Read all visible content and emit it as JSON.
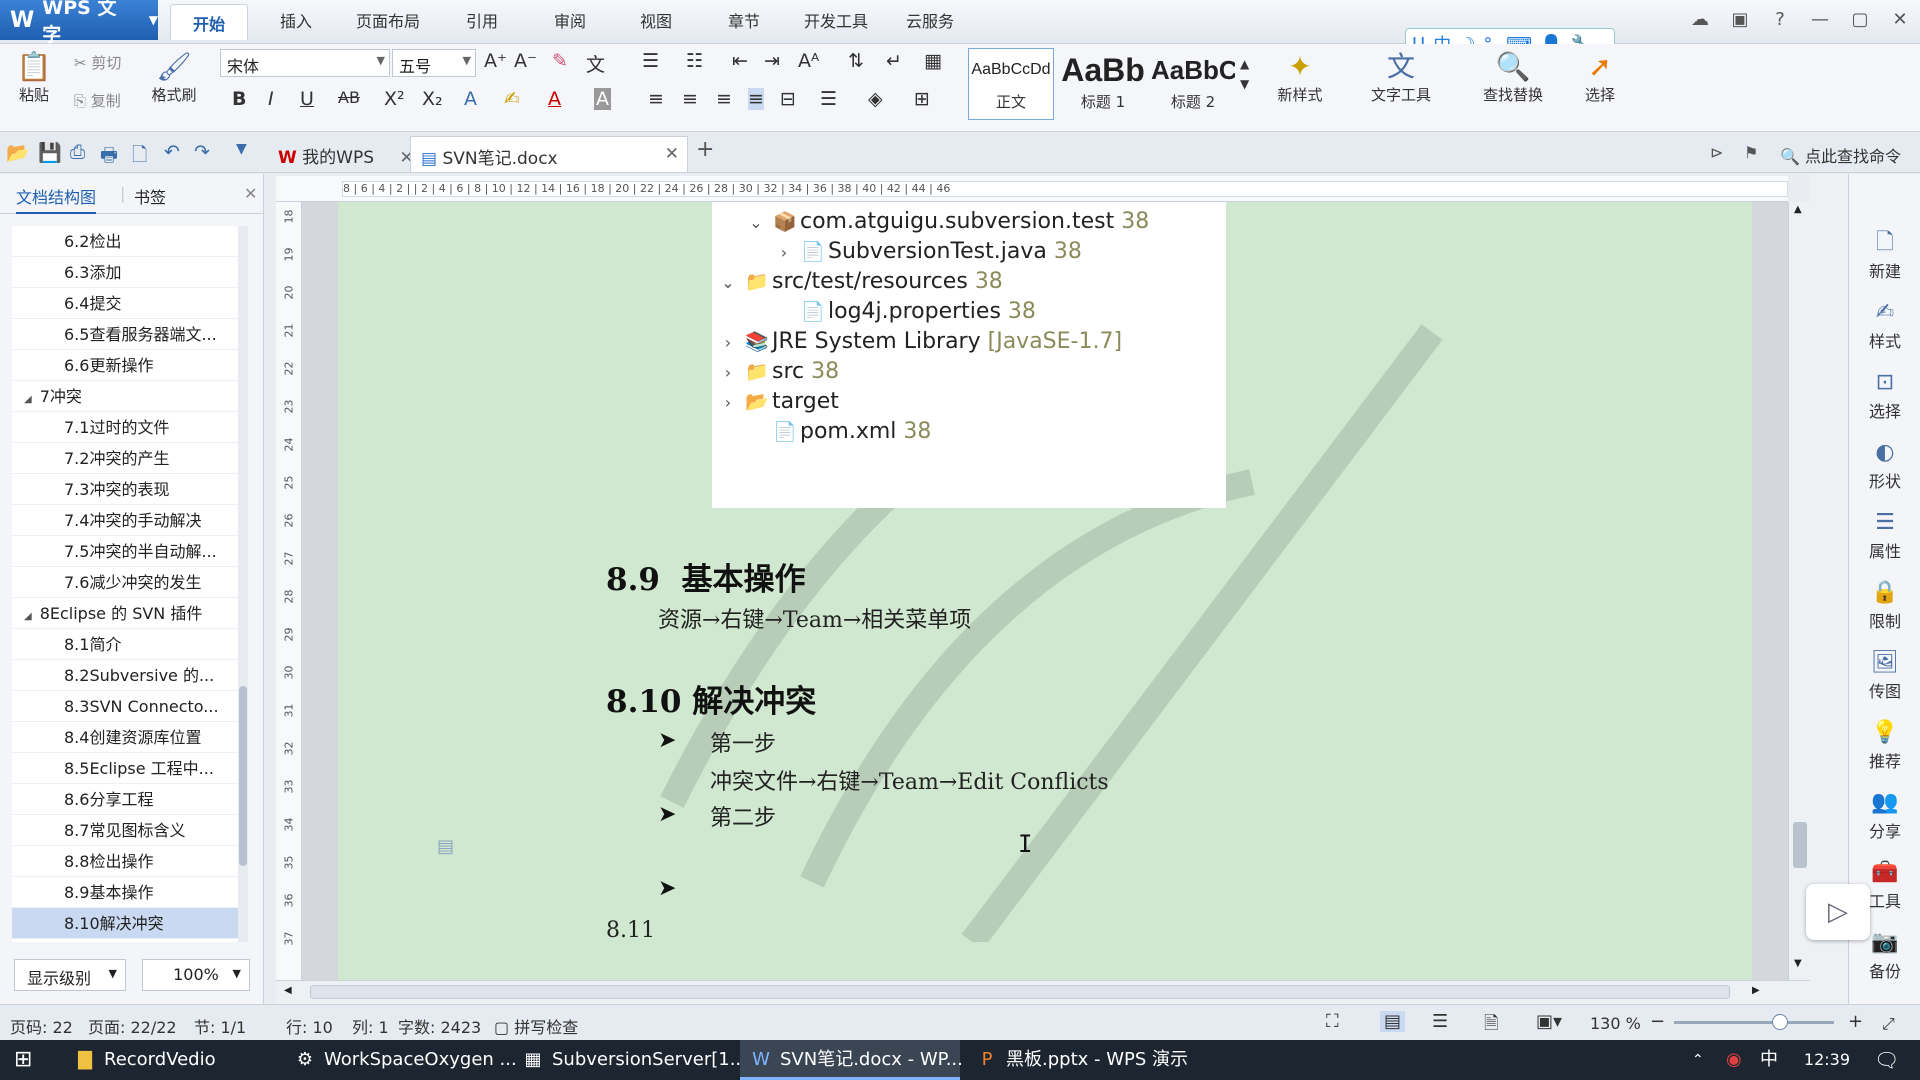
{
  "app": {
    "name": "WPS 文字",
    "logo": "W"
  },
  "menu": [
    "开始",
    "插入",
    "页面布局",
    "引用",
    "审阅",
    "视图",
    "章节",
    "开发工具",
    "云服务"
  ],
  "window_controls": [
    "☁",
    "▣",
    "?",
    "—",
    "▢",
    "✕"
  ],
  "ime": [
    "U",
    "中",
    "☽",
    "°,",
    "⌨",
    "👤",
    "🔧"
  ],
  "ribbon": {
    "paste": "粘贴",
    "cut": "剪切",
    "copy": "复制",
    "format_painter": "格式刷",
    "font_name": "宋体",
    "font_size": "五号",
    "styles": [
      {
        "sample": "AaBbCcDd",
        "label": "正文"
      },
      {
        "sample": "AaBb",
        "label": "标题 1"
      },
      {
        "sample": "AaBbC",
        "label": "标题 2"
      }
    ],
    "new_style": "新样式",
    "text_tools": "文字工具",
    "find_replace": "查找替换",
    "select": "选择"
  },
  "tabs": [
    {
      "label": "我的WPS"
    },
    {
      "label": "SVN笔记.docx"
    }
  ],
  "find_command": "点此查找命令",
  "left_panel": {
    "tab_outline": "文档结构图",
    "tab_bookmark": "书签",
    "items": [
      {
        "label": "6.2检出",
        "level": 2
      },
      {
        "label": "6.3添加",
        "level": 2
      },
      {
        "label": "6.4提交",
        "level": 2
      },
      {
        "label": "6.5查看服务器端文...",
        "level": 2
      },
      {
        "label": "6.6更新操作",
        "level": 2
      },
      {
        "label": "7冲突",
        "level": 1
      },
      {
        "label": "7.1过时的文件",
        "level": 2
      },
      {
        "label": "7.2冲突的产生",
        "level": 2
      },
      {
        "label": "7.3冲突的表现",
        "level": 2
      },
      {
        "label": "7.4冲突的手动解决",
        "level": 2
      },
      {
        "label": "7.5冲突的半自动解...",
        "level": 2
      },
      {
        "label": "7.6减少冲突的发生",
        "level": 2
      },
      {
        "label": "8Eclipse 的 SVN 插件",
        "level": 1
      },
      {
        "label": "8.1简介",
        "level": 2
      },
      {
        "label": "8.2Subversive 的...",
        "level": 2
      },
      {
        "label": "8.3SVN Connecto...",
        "level": 2
      },
      {
        "label": "8.4创建资源库位置",
        "level": 2
      },
      {
        "label": "8.5Eclipse 工程中...",
        "level": 2
      },
      {
        "label": "8.6分享工程",
        "level": 2
      },
      {
        "label": "8.7常见图标含义",
        "level": 2
      },
      {
        "label": "8.8检出操作",
        "level": 2
      },
      {
        "label": "8.9基本操作",
        "level": 2
      },
      {
        "label": "8.10解决冲突",
        "level": 2
      }
    ],
    "show_level": "显示级别",
    "zoom": "100%"
  },
  "hruler_text": "8 | 6 | 4 | 2 |   | 2 | 4 | 6 | 8 | 10 | 12 | 14 | 16 | 18 | 20 | 22 | 24 | 26 | 28 | 30 | 32 | 34 | 36 | 38 | 40 | 42 | 44 | 46",
  "vruler": [
    "18",
    "19",
    "20",
    "21",
    "22",
    "23",
    "24",
    "25",
    "26",
    "27",
    "28",
    "29",
    "30",
    "31",
    "32",
    "33",
    "34",
    "35",
    "36",
    "37"
  ],
  "tree": [
    {
      "label": "com.atguigu.subversion.test",
      "rev": "38",
      "expanded": true
    },
    {
      "label": "SubversionTest.java",
      "rev": "38",
      "expanded": false
    },
    {
      "label": "src/test/resources",
      "rev": "38",
      "expanded": true
    },
    {
      "label": "log4j.properties",
      "rev": "38"
    },
    {
      "label": "JRE System Library",
      "rev": "[JavaSE-1.7]",
      "expanded": false
    },
    {
      "label": "src",
      "rev": "38",
      "expanded": false
    },
    {
      "label": "target",
      "rev": "",
      "expanded": false
    },
    {
      "label": "pom.xml",
      "rev": "38"
    }
  ],
  "doc": {
    "h89_num": "8.9",
    "h89_title": "基本操作",
    "p89": "资源→右键→Team→相关菜单项",
    "h810": "8.10 解决冲突",
    "step1": "第一步",
    "step1_detail": "冲突文件→右键→Team→Edit Conflicts",
    "step2": "第二步",
    "h811": "8.11"
  },
  "right_toolbar": [
    "新建",
    "样式",
    "选择",
    "形状",
    "属性",
    "限制",
    "传图",
    "推荐",
    "分享",
    "工具",
    "备份"
  ],
  "status": {
    "page_code": "页码: 22",
    "pages": "页面: 22/22",
    "section": "节: 1/1",
    "row": "行: 10",
    "col": "列: 1",
    "words": "字数: 2423",
    "spell": "拼写检查",
    "zoom": "130 %"
  },
  "taskbar": [
    {
      "label": "RecordVedio"
    },
    {
      "label": "WorkSpaceOxygen ..."
    },
    {
      "label": "SubversionServer[1..."
    },
    {
      "label": "SVN笔记.docx - WP..."
    },
    {
      "label": "黑板.pptx - WPS 演示"
    }
  ],
  "clock": "12:39",
  "tray_ime": "中",
  "colors": {
    "accent": "#1f5fb0",
    "page_bg": "#cfe8cf",
    "taskbar": "#1c2530"
  }
}
